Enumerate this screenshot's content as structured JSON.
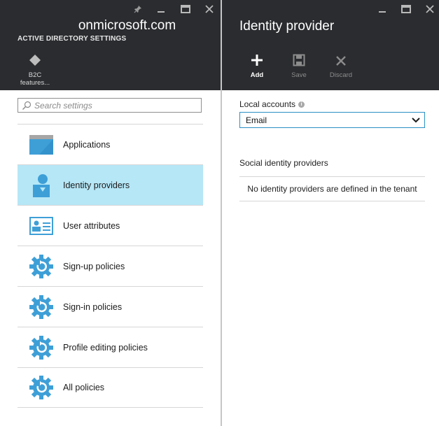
{
  "left_blade": {
    "title": "onmicrosoft.com",
    "subtitle": "ACTIVE DIRECTORY SETTINGS",
    "commands": [
      {
        "label_line1": "B2C",
        "label_line2": "features...",
        "icon": "diamond-icon"
      }
    ],
    "search": {
      "placeholder": "Search settings",
      "value": ""
    },
    "menu": [
      {
        "label": "Applications",
        "icon": "applications-icon",
        "selected": false
      },
      {
        "label": "Identity providers",
        "icon": "identity-provider-icon",
        "selected": true
      },
      {
        "label": "User attributes",
        "icon": "user-attributes-icon",
        "selected": false
      },
      {
        "label": "Sign-up policies",
        "icon": "policy-gear-icon",
        "selected": false
      },
      {
        "label": "Sign-in policies",
        "icon": "policy-gear-icon",
        "selected": false
      },
      {
        "label": "Profile editing policies",
        "icon": "policy-gear-icon",
        "selected": false
      },
      {
        "label": "All policies",
        "icon": "policy-gear-icon",
        "selected": false
      }
    ]
  },
  "right_blade": {
    "title": "Identity provider",
    "commands": [
      {
        "label": "Add",
        "icon": "plus-icon",
        "enabled": true
      },
      {
        "label": "Save",
        "icon": "save-icon",
        "enabled": false
      },
      {
        "label": "Discard",
        "icon": "close-icon",
        "enabled": false
      }
    ],
    "local_accounts": {
      "label": "Local accounts",
      "selected": "Email"
    },
    "social": {
      "label": "Social identity providers",
      "empty_message": "No identity providers are defined in the tenant"
    }
  },
  "colors": {
    "header_bg": "#2a2c2f",
    "selected_bg": "#b6e7f7",
    "accent_blue": "#3e9fd7",
    "select_border": "#2a8fc4"
  }
}
